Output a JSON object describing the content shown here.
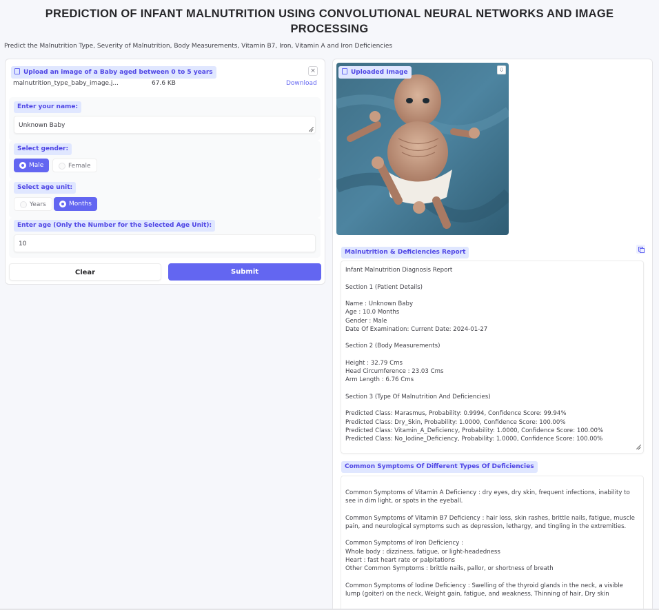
{
  "header": {
    "title": "PREDICTION OF INFANT MALNUTRITION USING CONVOLUTIONAL NEURAL NETWORKS AND IMAGE PROCESSING",
    "subtitle": "Predict the Malnutrition Type, Severity of Malnutrition, Body Measurements, Vitamin B7, Iron, Vitamin A and Iron Deficiencies"
  },
  "upload": {
    "label": "Upload an image of a Baby aged between 0 to 5 years",
    "file_name": "malnutrition_type_baby_image.j...",
    "file_size": "67.6 KB",
    "download_label": "Download",
    "close_symbol": "×"
  },
  "name_field": {
    "label": "Enter your name:",
    "value": "Unknown Baby"
  },
  "gender": {
    "label": "Select gender:",
    "options": [
      "Male",
      "Female"
    ],
    "selected": "Male"
  },
  "age_unit": {
    "label": "Select age unit:",
    "options": [
      "Years",
      "Months"
    ],
    "selected": "Months"
  },
  "age_field": {
    "label": "Enter age (Only the Number for the Selected Age Unit):",
    "value": "10"
  },
  "buttons": {
    "clear": "Clear",
    "submit": "Submit"
  },
  "uploaded_image": {
    "label": "Uploaded Image"
  },
  "report": {
    "label": "Malnutrition & Deficiencies Report",
    "lines": [
      "Infant Malnutrition Diagnosis Report",
      " Section 1 (Patient Details)",
      " Name : Unknown Baby",
      " Age : 10.0 Months",
      " Gender : Male",
      " Date Of Examination: Current Date: 2024-01-27",
      "Section 2 (Body Measurements)",
      " Height : 32.79 Cms",
      " Head Circumference : 23.03 Cms",
      " Arm Length : 6.76 Cms",
      "Section 3 (Type Of Malnutrition And Deficiencies)",
      "Predicted Class: Marasmus, Probability: 0.9994, Confidence Score: 99.94%",
      "Predicted Class: Dry_Skin, Probability: 1.0000, Confidence Score: 100.00%",
      "Predicted Class: Vitamin_A_Deficiency, Probability: 1.0000, Confidence Score: 100.00%",
      "Predicted Class: No_Iodine_Deficiency, Probability: 1.0000, Confidence Score: 100.00%"
    ]
  },
  "symptoms": {
    "label": "Common Symptoms Of Different Types Of Deficiencies",
    "lines": [
      "Common Symptoms of Vitamin A Deficiency : dry eyes, dry skin, frequent infections, inability to",
      "see in dim light, or spots in the eyeball.",
      " Common Symptoms of Vitamin B7 Deficiency : hair loss, skin rashes, brittle nails, fatigue, muscle",
      "pain, and neurological symptoms such as depression, lethargy, and tingling in the extremities.",
      " Common Symptoms of Iron Deficiency :",
      " Whole body : dizziness, fatigue, or light-headedness",
      " Heart : fast heart rate or palpitations",
      " Other Common Symptoms : brittle nails, pallor, or shortness of breath",
      " Common Symptoms of Iodine Deficiency : Swelling of the thyroid glands in the neck, a visible",
      "lump (goiter) on the neck, Weight gain, fatigue, and weakness, Thinning of hair, Dry skin"
    ]
  },
  "colors": {
    "accent": "#6366f1",
    "chip_bg": "#e0e7ff",
    "page_bg": "#f6f7fb"
  },
  "icons": [
    "file-icon",
    "close-icon",
    "image-icon",
    "download-icon",
    "copy-icon",
    "resize-handle-icon"
  ]
}
